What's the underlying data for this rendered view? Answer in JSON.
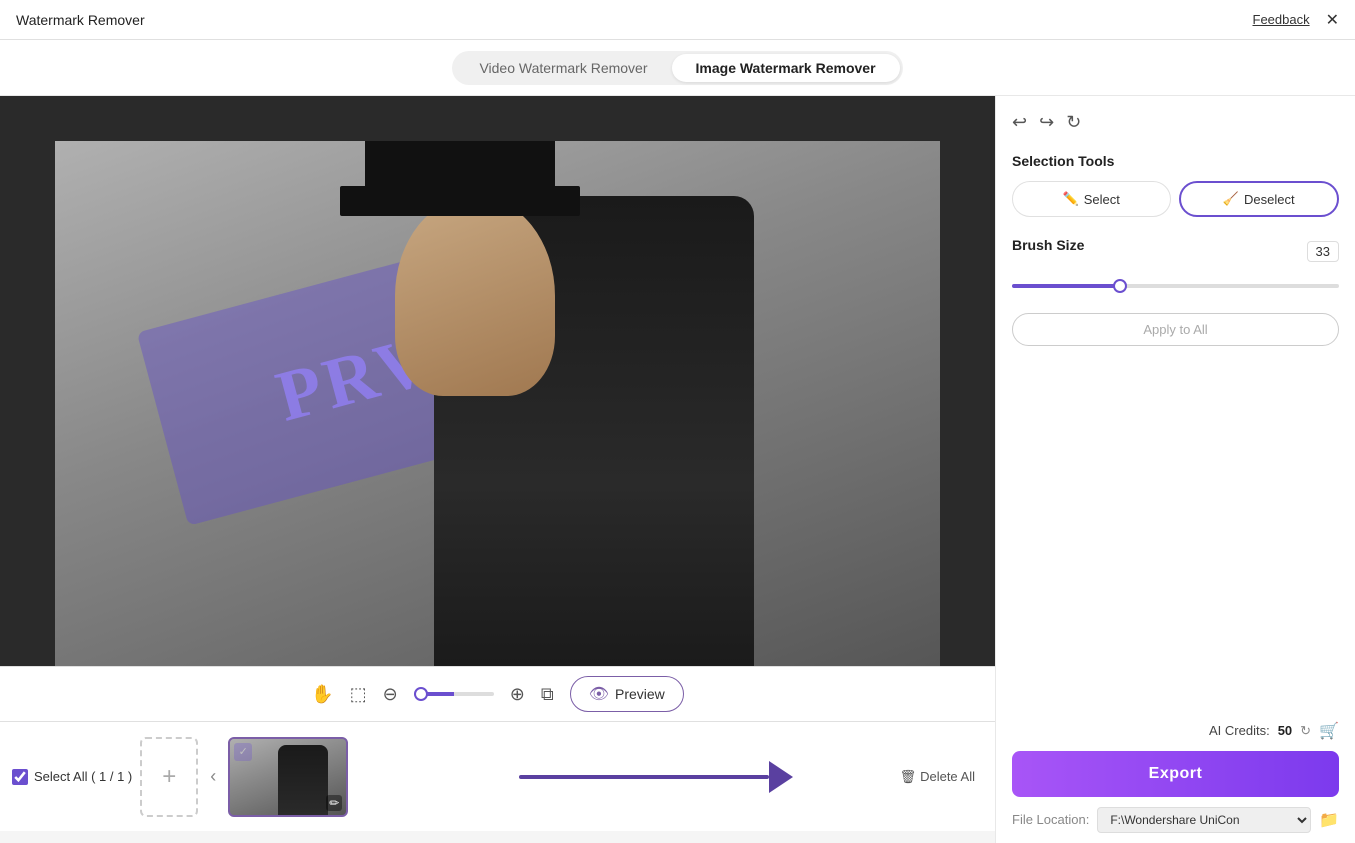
{
  "app": {
    "title": "Watermark Remover",
    "feedback_label": "Feedback",
    "close_label": "✕"
  },
  "tabs": {
    "items": [
      {
        "id": "video",
        "label": "Video Watermark Remover",
        "active": false
      },
      {
        "id": "image",
        "label": "Image Watermark Remover",
        "active": true
      }
    ]
  },
  "toolbar": {
    "zoom_min": "0",
    "zoom_max": "100",
    "zoom_value": "0",
    "preview_label": "Preview"
  },
  "right_panel": {
    "selection_tools_label": "Selection Tools",
    "select_btn": "Select",
    "deselect_btn": "Deselect",
    "brush_size_label": "Brush Size",
    "brush_value": "33",
    "apply_btn": "Apply to All"
  },
  "bottom": {
    "select_all_label": "Select All ( 1 / 1 )",
    "delete_all_label": "Delete All",
    "add_btn": "+",
    "export_btn": "Export",
    "file_location_label": "File Location:",
    "file_location_value": "F:\\Wondershare UniCon",
    "ai_credits_label": "AI Credits:",
    "ai_credits_value": "50"
  },
  "watermark": {
    "text": "PRVT"
  }
}
